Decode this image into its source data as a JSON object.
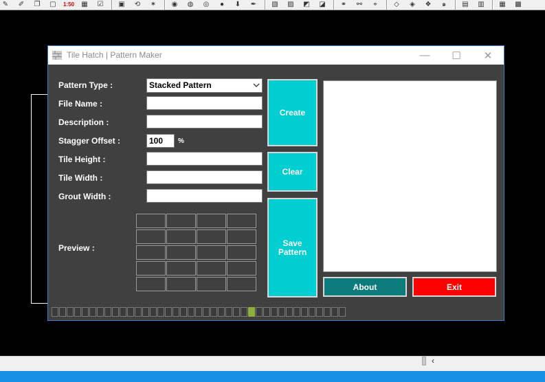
{
  "host": {
    "toolbar_icons": [
      "pencil-icon",
      "copy-icon",
      "stamp-icon",
      "rectangle-icon",
      "scale-icon",
      "grid-icon",
      "check-icon",
      "box-icon",
      "rotate-icon",
      "explode-icon",
      "refresh-icon",
      "palette-icon",
      "globe-icon",
      "recycle-icon",
      "pen-icon",
      "hatch-icon",
      "frame-icon",
      "select-icon",
      "align-icon",
      "image-icon",
      "link-icon",
      "crosshair-icon",
      "pen-tool-icon",
      "layer-icon",
      "layer-icon",
      "layer-icon",
      "swirl-icon",
      "table-icon",
      "table-icon",
      "table-icon",
      "table-icon"
    ],
    "scale_label": "1:50"
  },
  "window": {
    "title": "Tile Hatch | Pattern Maker",
    "minimize_glyph": "—",
    "maximize_glyph": "☐",
    "close_glyph": "✕"
  },
  "form": {
    "pattern_type_label": "Pattern Type :",
    "pattern_type_value": "Stacked Pattern",
    "file_name_label": "File Name :",
    "file_name_value": "",
    "description_label": "Description :",
    "description_value": "",
    "stagger_offset_label": "Stagger Offset :",
    "stagger_offset_value": "100",
    "stagger_offset_unit": "%",
    "tile_height_label": "Tile Height :",
    "tile_height_value": "",
    "tile_width_label": "Tile Width :",
    "tile_width_value": "",
    "grout_width_label": "Grout Width :",
    "grout_width_value": "",
    "preview_label": "Preview :"
  },
  "buttons": {
    "create": "Create",
    "clear": "Clear",
    "save_pattern_line1": "Save",
    "save_pattern_line2": "Pattern",
    "about": "About",
    "exit": "Exit"
  },
  "colors": {
    "accent": "#00ced1",
    "about": "#0b7b7b",
    "exit": "#ff0000",
    "window_bg": "#404040",
    "selected_pattern": "#8fae3a"
  },
  "pattern_strip": {
    "count": 39,
    "selected_index": 26
  }
}
